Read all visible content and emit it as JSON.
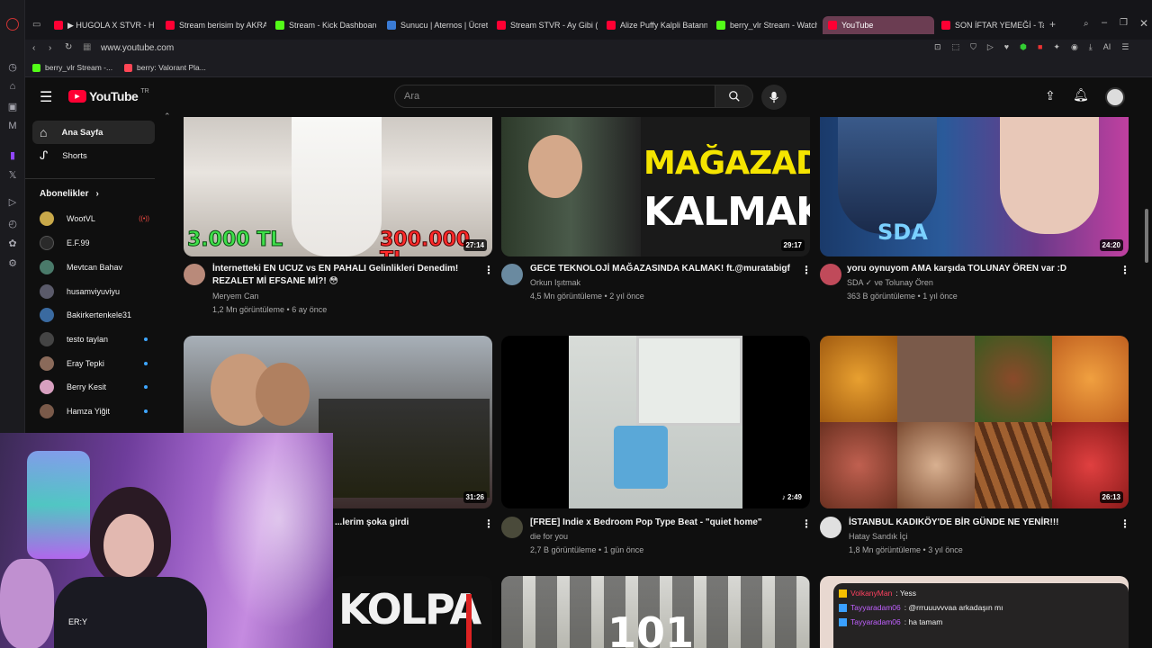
{
  "browser": {
    "tabs": [
      {
        "label": "▶ HUGOLA X STVR - HU",
        "icon": "youtube-favicon"
      },
      {
        "label": "Stream berisim by AKRA",
        "icon": "youtube-favicon"
      },
      {
        "label": "Stream - Kick Dashboard",
        "icon": "kick-favicon"
      },
      {
        "label": "Sunucu | Aternos | Ücret",
        "icon": "aternos-favicon"
      },
      {
        "label": "Stream STVR - Ay Gibi (p",
        "icon": "youtube-favicon"
      },
      {
        "label": "Alize Puffy Kalpli Batann",
        "icon": "youtube-favicon"
      },
      {
        "label": "berry_vlr Stream - Watch",
        "icon": "kick-favicon"
      },
      {
        "label": "YouTube",
        "icon": "youtube-favicon",
        "active": true
      },
      {
        "label": "SON İFTAR YEMEĞİ - Tal",
        "icon": "youtube-favicon"
      }
    ],
    "url": "www.youtube.com",
    "bookmarks": [
      {
        "label": "berry_vlr Stream -...",
        "icon": "kick-favicon"
      },
      {
        "label": "berry: Valorant Pla...",
        "icon": "valorant-favicon"
      }
    ],
    "toolbar_ai": "AI"
  },
  "youtube": {
    "logo": "YouTube",
    "logo_region": "TR",
    "search_placeholder": "Ara",
    "sidebar": {
      "home": "Ana Sayfa",
      "shorts": "Shorts",
      "subscriptions_heading": "Abonelikler",
      "subscriptions": [
        {
          "name": "WootVL",
          "badge": "live",
          "color": "#c9a94a"
        },
        {
          "name": "E.F.99",
          "badge": "",
          "color": "#2a2a2a"
        },
        {
          "name": "Mevtcan Bahav",
          "badge": "",
          "color": "#4a7a6a"
        },
        {
          "name": "husamviyuviyu",
          "badge": "",
          "color": "#5a5a6a"
        },
        {
          "name": "Bakirkertenkele31",
          "badge": "",
          "color": "#3a6aa0"
        },
        {
          "name": "testo taylan",
          "badge": "dot",
          "color": "#444"
        },
        {
          "name": "Eray Tepki",
          "badge": "dot",
          "color": "#8a6a5a"
        },
        {
          "name": "Berry Kesit",
          "badge": "dot",
          "color": "#d8a0c0"
        },
        {
          "name": "Hamza Yiğit",
          "badge": "dot",
          "color": "#7a5a4a"
        }
      ],
      "partial_bottom": "ER:Y"
    },
    "videos": [
      {
        "title_1": "İnternetteki EN UCUZ vs EN PAHALI Gelinlikleri Denedim!",
        "title_2": "REZALET Mİ EFSANE Mİ?! 😳",
        "channel": "Meryem Can",
        "stats": "1,2 Mn görüntüleme • 6 ay önce",
        "duration": "27:14",
        "thumb_text_1": "3.000 TL",
        "thumb_text_2": "300.000 TL",
        "avatar_color": "#b98a7a"
      },
      {
        "title_1": "GECE TEKNOLOJİ MAĞAZASINDA KALMAK! ft.@muratabigf",
        "title_2": "",
        "channel": "Orkun Işıtmak",
        "stats": "4,5 Mn görüntüleme • 2 yıl önce",
        "duration": "29:17",
        "thumb_text_1": "MAĞAZADA",
        "thumb_text_2": "KALMAK!",
        "avatar_color": "#6a8aa0"
      },
      {
        "title_1": "yoru oynuyom AMA karşıda TOLUNAY ÖREN var :D",
        "title_2": "",
        "channel": "SDA ✓ ve Tolunay Ören",
        "stats": "363 B görüntüleme • 1 yıl önce",
        "duration": "24:20",
        "thumb_text_1": "SDA",
        "thumb_text_2": "",
        "avatar_color": "#c04a5a"
      },
      {
        "title_1": "...lerim şoka girdi",
        "title_2": "",
        "channel": "",
        "stats": "",
        "duration": "31:26",
        "thumb_text_1": "",
        "thumb_text_2": "",
        "avatar_color": "#555"
      },
      {
        "title_1": "[FREE] Indie x Bedroom Pop Type Beat - \"quiet home\"",
        "title_2": "",
        "channel": "die for you",
        "stats": "2,7 B görüntüleme • 1 gün önce",
        "duration": "♪ 2:49",
        "thumb_text_1": "",
        "thumb_text_2": "",
        "avatar_color": "#4a4a3a"
      },
      {
        "title_1": "İSTANBUL KADIKÖY'DE BİR GÜNDE NE YENİR!!!",
        "title_2": "",
        "channel": "Hatay Sandık İçi",
        "stats": "1,8 Mn görüntüleme • 3 yıl önce",
        "duration": "26:13",
        "thumb_text_1": "",
        "thumb_text_2": "",
        "avatar_color": "#e0e0e0"
      }
    ],
    "partial_row_texts": [
      "KOLPA",
      "101"
    ]
  },
  "chat": [
    {
      "user": "VolkanyMan",
      "message": ": Yess",
      "color": "#ff4060"
    },
    {
      "user": "Tayyaradam06",
      "message": ": @rrruuuvvvaa arkadaşın mı",
      "color": "#c060ff"
    },
    {
      "user": "Tayyaradam06",
      "message": ": ha tamam",
      "color": "#c060ff"
    }
  ]
}
